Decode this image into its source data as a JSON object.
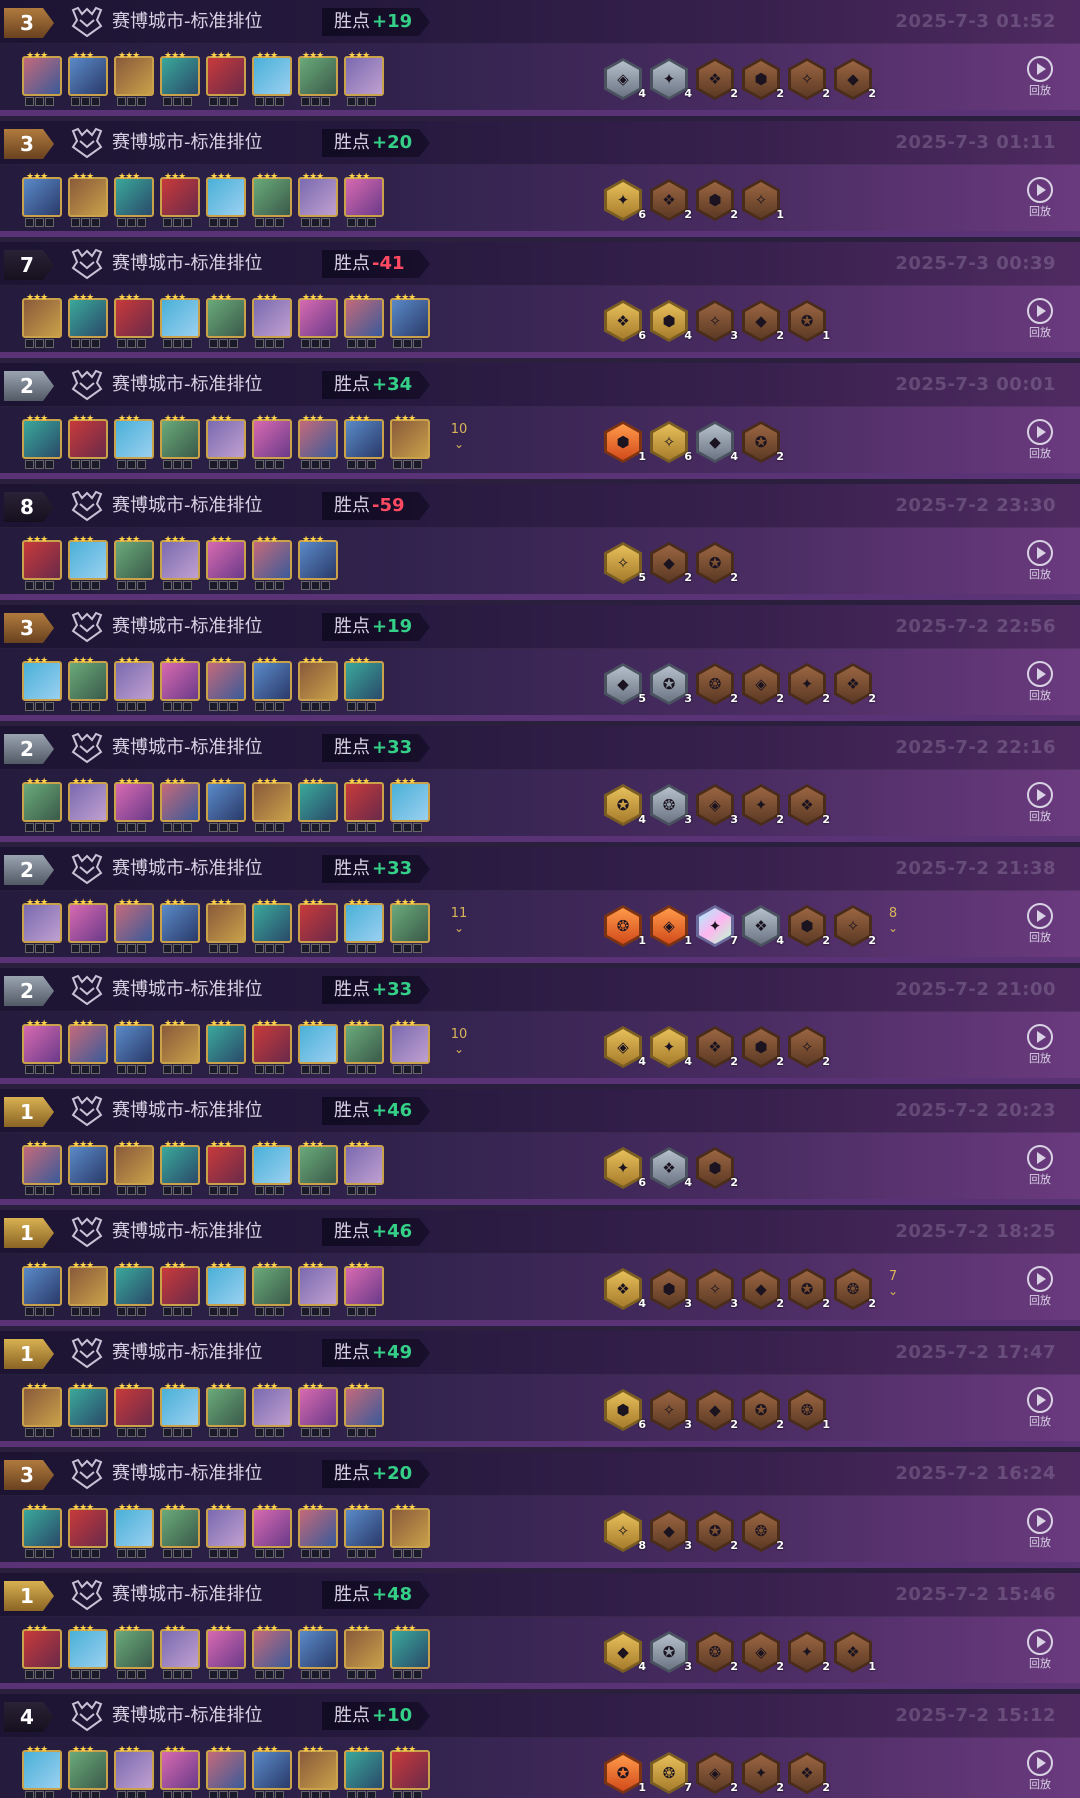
{
  "matches": [
    {
      "rank": "3",
      "rank_color": "bronze",
      "mode": "赛博城市-标准排位",
      "points_label": "胜点",
      "delta": "+19",
      "sign": "pos",
      "time": "2025-7-3 01:52",
      "units": 8,
      "more": "",
      "traits": [
        {
          "c": "silver",
          "n": "4"
        },
        {
          "c": "silver",
          "n": "4"
        },
        {
          "c": "bronze",
          "n": "2"
        },
        {
          "c": "bronze",
          "n": "2"
        },
        {
          "c": "bronze",
          "n": "2"
        },
        {
          "c": "bronze",
          "n": "2"
        }
      ],
      "more_traits": "",
      "replay": "回放"
    },
    {
      "rank": "3",
      "rank_color": "bronze",
      "mode": "赛博城市-标准排位",
      "points_label": "胜点",
      "delta": "+20",
      "sign": "pos",
      "time": "2025-7-3 01:11",
      "units": 8,
      "more": "",
      "traits": [
        {
          "c": "gold",
          "n": "6"
        },
        {
          "c": "bronze",
          "n": "2"
        },
        {
          "c": "bronze",
          "n": "2"
        },
        {
          "c": "bronze",
          "n": "1"
        }
      ],
      "more_traits": "",
      "replay": "回放"
    },
    {
      "rank": "7",
      "rank_color": "dark",
      "mode": "赛博城市-标准排位",
      "points_label": "胜点",
      "delta": "-41",
      "sign": "neg",
      "time": "2025-7-3 00:39",
      "units": 9,
      "more": "",
      "traits": [
        {
          "c": "gold",
          "n": "6"
        },
        {
          "c": "gold",
          "n": "4"
        },
        {
          "c": "bronze",
          "n": "3"
        },
        {
          "c": "bronze",
          "n": "2"
        },
        {
          "c": "bronze",
          "n": "1"
        }
      ],
      "more_traits": "",
      "replay": "回放"
    },
    {
      "rank": "2",
      "rank_color": "silver",
      "mode": "赛博城市-标准排位",
      "points_label": "胜点",
      "delta": "+34",
      "sign": "pos",
      "time": "2025-7-3 00:01",
      "units": 9,
      "more": "10",
      "traits": [
        {
          "c": "orange",
          "n": "1"
        },
        {
          "c": "gold",
          "n": "6"
        },
        {
          "c": "silver",
          "n": "4"
        },
        {
          "c": "bronze",
          "n": "2"
        }
      ],
      "more_traits": "",
      "replay": "回放"
    },
    {
      "rank": "8",
      "rank_color": "dark",
      "mode": "赛博城市-标准排位",
      "points_label": "胜点",
      "delta": "-59",
      "sign": "neg",
      "time": "2025-7-2 23:30",
      "units": 7,
      "more": "",
      "traits": [
        {
          "c": "gold",
          "n": "5"
        },
        {
          "c": "bronze",
          "n": "2"
        },
        {
          "c": "bronze",
          "n": "2"
        }
      ],
      "more_traits": "",
      "replay": "回放"
    },
    {
      "rank": "3",
      "rank_color": "bronze",
      "mode": "赛博城市-标准排位",
      "points_label": "胜点",
      "delta": "+19",
      "sign": "pos",
      "time": "2025-7-2 22:56",
      "units": 8,
      "more": "",
      "traits": [
        {
          "c": "silver",
          "n": "5"
        },
        {
          "c": "silver",
          "n": "3"
        },
        {
          "c": "bronze",
          "n": "2"
        },
        {
          "c": "bronze",
          "n": "2"
        },
        {
          "c": "bronze",
          "n": "2"
        },
        {
          "c": "bronze",
          "n": "2"
        }
      ],
      "more_traits": "",
      "replay": "回放"
    },
    {
      "rank": "2",
      "rank_color": "silver",
      "mode": "赛博城市-标准排位",
      "points_label": "胜点",
      "delta": "+33",
      "sign": "pos",
      "time": "2025-7-2 22:16",
      "units": 9,
      "more": "",
      "traits": [
        {
          "c": "gold",
          "n": "4"
        },
        {
          "c": "silver",
          "n": "3"
        },
        {
          "c": "bronze",
          "n": "3"
        },
        {
          "c": "bronze",
          "n": "2"
        },
        {
          "c": "bronze",
          "n": "2"
        }
      ],
      "more_traits": "",
      "replay": "回放"
    },
    {
      "rank": "2",
      "rank_color": "silver",
      "mode": "赛博城市-标准排位",
      "points_label": "胜点",
      "delta": "+33",
      "sign": "pos",
      "time": "2025-7-2 21:38",
      "units": 9,
      "more": "11",
      "traits": [
        {
          "c": "orange",
          "n": "1"
        },
        {
          "c": "orange",
          "n": "1"
        },
        {
          "c": "prism",
          "n": "7"
        },
        {
          "c": "silver",
          "n": "4"
        },
        {
          "c": "bronze",
          "n": "2"
        },
        {
          "c": "bronze",
          "n": "2"
        }
      ],
      "more_traits": "8",
      "replay": "回放"
    },
    {
      "rank": "2",
      "rank_color": "silver",
      "mode": "赛博城市-标准排位",
      "points_label": "胜点",
      "delta": "+33",
      "sign": "pos",
      "time": "2025-7-2 21:00",
      "units": 9,
      "more": "10",
      "traits": [
        {
          "c": "gold",
          "n": "4"
        },
        {
          "c": "gold",
          "n": "4"
        },
        {
          "c": "bronze",
          "n": "2"
        },
        {
          "c": "bronze",
          "n": "2"
        },
        {
          "c": "bronze",
          "n": "2"
        }
      ],
      "more_traits": "",
      "replay": "回放"
    },
    {
      "rank": "1",
      "rank_color": "gold",
      "mode": "赛博城市-标准排位",
      "points_label": "胜点",
      "delta": "+46",
      "sign": "pos",
      "time": "2025-7-2 20:23",
      "units": 8,
      "more": "",
      "traits": [
        {
          "c": "gold",
          "n": "6"
        },
        {
          "c": "silver",
          "n": "4"
        },
        {
          "c": "bronze",
          "n": "2"
        }
      ],
      "more_traits": "",
      "replay": "回放"
    },
    {
      "rank": "1",
      "rank_color": "gold",
      "mode": "赛博城市-标准排位",
      "points_label": "胜点",
      "delta": "+46",
      "sign": "pos",
      "time": "2025-7-2 18:25",
      "units": 8,
      "more": "",
      "traits": [
        {
          "c": "gold",
          "n": "4"
        },
        {
          "c": "bronze",
          "n": "3"
        },
        {
          "c": "bronze",
          "n": "3"
        },
        {
          "c": "bronze",
          "n": "2"
        },
        {
          "c": "bronze",
          "n": "2"
        },
        {
          "c": "bronze",
          "n": "2"
        }
      ],
      "more_traits": "7",
      "replay": "回放"
    },
    {
      "rank": "1",
      "rank_color": "gold",
      "mode": "赛博城市-标准排位",
      "points_label": "胜点",
      "delta": "+49",
      "sign": "pos",
      "time": "2025-7-2 17:47",
      "units": 8,
      "more": "",
      "traits": [
        {
          "c": "gold",
          "n": "6"
        },
        {
          "c": "bronze",
          "n": "3"
        },
        {
          "c": "bronze",
          "n": "2"
        },
        {
          "c": "bronze",
          "n": "2"
        },
        {
          "c": "bronze",
          "n": "1"
        }
      ],
      "more_traits": "",
      "replay": "回放"
    },
    {
      "rank": "3",
      "rank_color": "bronze",
      "mode": "赛博城市-标准排位",
      "points_label": "胜点",
      "delta": "+20",
      "sign": "pos",
      "time": "2025-7-2 16:24",
      "units": 9,
      "more": "",
      "traits": [
        {
          "c": "gold",
          "n": "8"
        },
        {
          "c": "bronze",
          "n": "3"
        },
        {
          "c": "bronze",
          "n": "2"
        },
        {
          "c": "bronze",
          "n": "2"
        }
      ],
      "more_traits": "",
      "replay": "回放"
    },
    {
      "rank": "1",
      "rank_color": "gold",
      "mode": "赛博城市-标准排位",
      "points_label": "胜点",
      "delta": "+48",
      "sign": "pos",
      "time": "2025-7-2 15:46",
      "units": 9,
      "more": "",
      "traits": [
        {
          "c": "gold",
          "n": "4"
        },
        {
          "c": "silver",
          "n": "3"
        },
        {
          "c": "bronze",
          "n": "2"
        },
        {
          "c": "bronze",
          "n": "2"
        },
        {
          "c": "bronze",
          "n": "2"
        },
        {
          "c": "bronze",
          "n": "1"
        }
      ],
      "more_traits": "",
      "replay": "回放"
    },
    {
      "rank": "4",
      "rank_color": "dark",
      "mode": "赛博城市-标准排位",
      "points_label": "胜点",
      "delta": "+10",
      "sign": "pos",
      "time": "2025-7-2 15:12",
      "units": 9,
      "more": "",
      "traits": [
        {
          "c": "orange",
          "n": "1"
        },
        {
          "c": "gold",
          "n": "7"
        },
        {
          "c": "bronze",
          "n": "2"
        },
        {
          "c": "bronze",
          "n": "2"
        },
        {
          "c": "bronze",
          "n": "2"
        }
      ],
      "more_traits": "",
      "replay": "回放"
    }
  ]
}
